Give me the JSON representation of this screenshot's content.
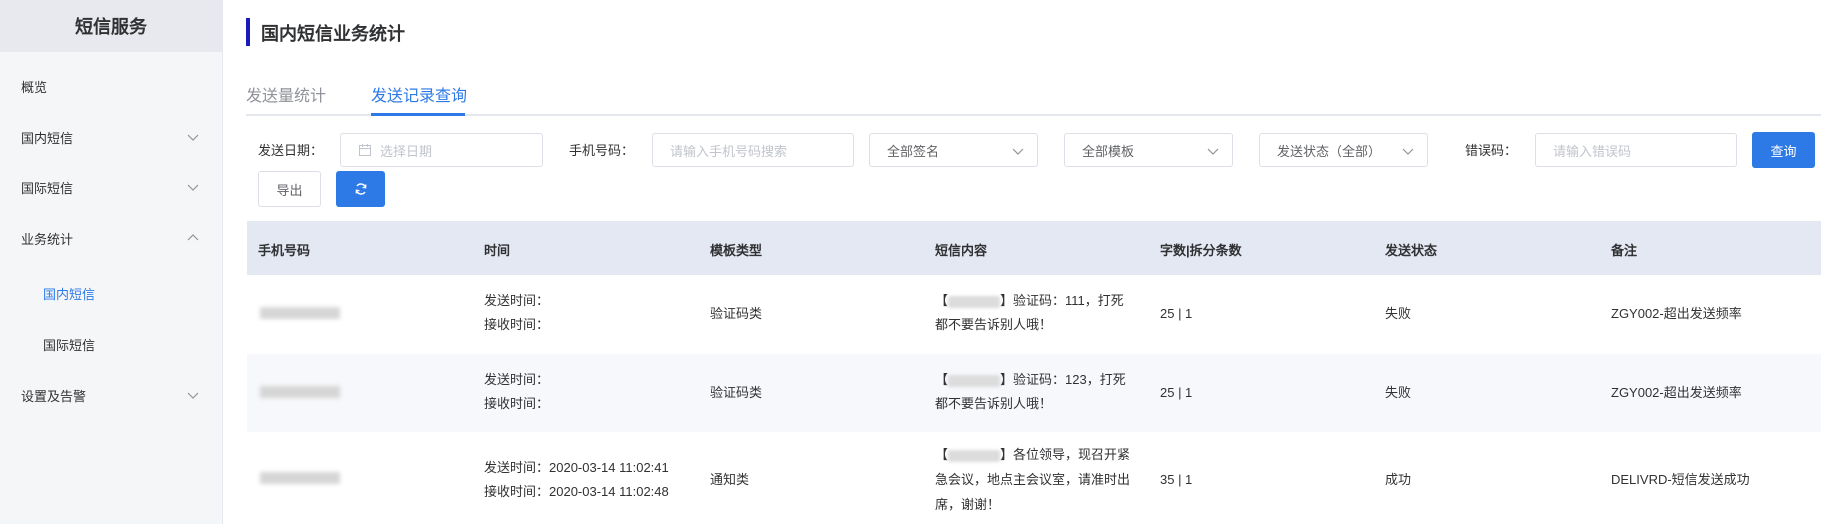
{
  "sidebar": {
    "title": "短信服务",
    "items": [
      {
        "label": "概览",
        "has_chevron": false
      },
      {
        "label": "国内短信",
        "has_chevron": true,
        "chevron": "down"
      },
      {
        "label": "国际短信",
        "has_chevron": true,
        "chevron": "down"
      },
      {
        "label": "业务统计",
        "has_chevron": true,
        "chevron": "up"
      },
      {
        "label": "国内短信",
        "sub": true,
        "active": true
      },
      {
        "label": "国际短信",
        "sub": true
      },
      {
        "label": "设置及告警",
        "has_chevron": true,
        "chevron": "down"
      }
    ]
  },
  "page": {
    "title": "国内短信业务统计"
  },
  "tabs": [
    {
      "label": "发送量统计",
      "active": false
    },
    {
      "label": "发送记录查询",
      "active": true
    }
  ],
  "filters": {
    "date_label": "发送日期：",
    "date_placeholder": "选择日期",
    "phone_label": "手机号码：",
    "phone_placeholder": "请输入手机号码搜索",
    "signature_select": "全部签名",
    "template_select": "全部模板",
    "status_select": "发送状态（全部）",
    "error_label": "错误码：",
    "error_placeholder": "请输入错误码",
    "query_button": "查询",
    "export_button": "导出",
    "refresh_icon": "refresh-icon"
  },
  "table": {
    "columns": [
      "手机号码",
      "时间",
      "模板类型",
      "短信内容",
      "字数|拆分条数",
      "发送状态",
      "备注"
    ],
    "rows": [
      {
        "send_time": "发送时间：",
        "recv_time": "接收时间：",
        "template_type": "验证码类",
        "content_line1_prefix": "【",
        "content_line1_suffix": "】验证码：111，打死",
        "content_line2": "都不要告诉别人哦！",
        "count": "25 | 1",
        "status": "失败",
        "remark": "ZGY002-超出发送频率"
      },
      {
        "send_time": "发送时间：",
        "recv_time": "接收时间：",
        "template_type": "验证码类",
        "content_line1_prefix": "【",
        "content_line1_suffix": "】验证码：123，打死",
        "content_line2": "都不要告诉别人哦！",
        "count": "25 | 1",
        "status": "失败",
        "remark": "ZGY002-超出发送频率"
      },
      {
        "send_time": "发送时间：2020-03-14 11:02:41",
        "recv_time": "接收时间：2020-03-14 11:02:48",
        "template_type": "通知类",
        "content_line1_prefix": "【",
        "content_line1_suffix": "】各位领导，现召开紧",
        "content_line2": "急会议，地点主会议室，请准时出",
        "content_line3": "席，谢谢！",
        "count": "35 | 1",
        "status": "成功",
        "remark": "DELIVRD-短信发送成功"
      }
    ]
  },
  "colors": {
    "accent": "#2d7ae6",
    "title_bar": "#1a1ab8",
    "header_bg": "#e4e8f2"
  }
}
